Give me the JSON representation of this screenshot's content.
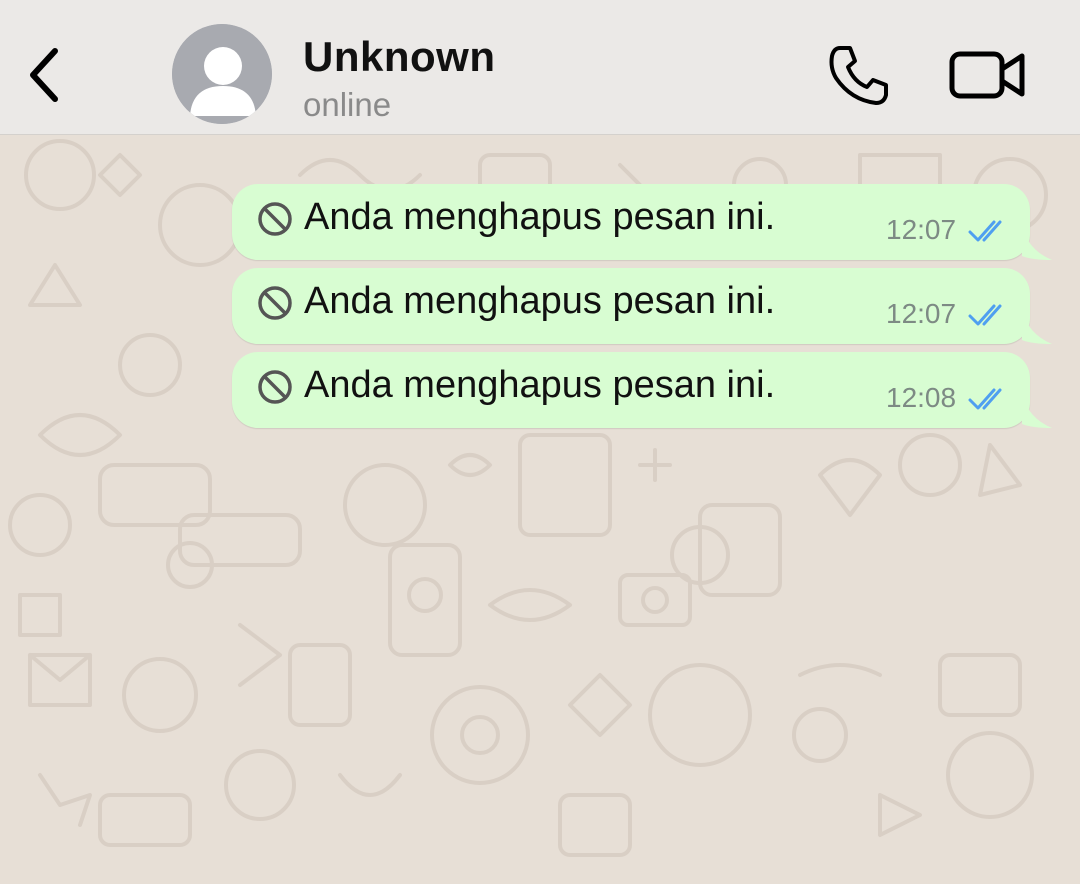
{
  "header": {
    "contact_name": "Unknown",
    "status": "online",
    "back_icon": "chevron-left-icon",
    "call_icon": "phone-icon",
    "video_icon": "video-camera-icon"
  },
  "messages": [
    {
      "text": "Anda menghapus pesan ini.",
      "time": "12:07",
      "status": "read"
    },
    {
      "text": "Anda menghapus pesan ini.",
      "time": "12:07",
      "status": "read"
    },
    {
      "text": "Anda menghapus pesan ini.",
      "time": "12:08",
      "status": "read"
    }
  ],
  "colors": {
    "header_bg": "#ebe9e7",
    "wallpaper_bg": "#e7dfd6",
    "outgoing_bubble": "#d8fdd2",
    "read_ticks": "#4f9ff0"
  }
}
